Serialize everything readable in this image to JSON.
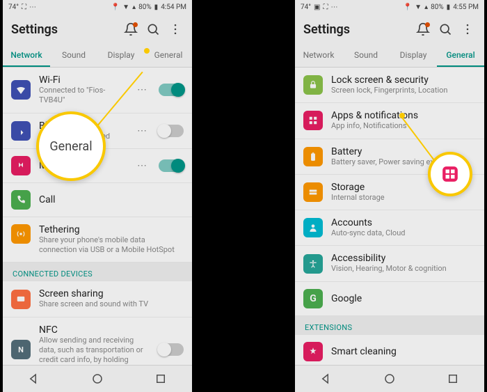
{
  "left": {
    "statusbar": {
      "temp": "74°",
      "battery": "80%",
      "time": "4:54 PM"
    },
    "title": "Settings",
    "tabs": [
      "Network",
      "Sound",
      "Display",
      "General"
    ],
    "active_tab": 0,
    "rows": {
      "wifi": {
        "title": "Wi-Fi",
        "sub": "Connected to \"Fios-TVB4U\"",
        "toggle": "on"
      },
      "bt": {
        "title": "Bluetooth",
        "sub": "Connections allowed",
        "toggle": "off"
      },
      "data": {
        "title": "Mobile data",
        "toggle": "on"
      },
      "call": {
        "title": "Call"
      },
      "tether": {
        "title": "Tethering",
        "sub": "Share your phone's mobile data connection via USB or a Mobile HotSpot"
      },
      "sect1": "CONNECTED DEVICES",
      "share": {
        "title": "Screen sharing",
        "sub": "Share screen and sound with TV"
      },
      "nfc": {
        "title": "NFC",
        "sub": "Allow sending and receiving data, such as transportation or credit card info, by holding phone and other device together",
        "toggle": "off"
      }
    },
    "callout_label": "General"
  },
  "right": {
    "statusbar": {
      "temp": "74°",
      "battery": "80%",
      "time": "4:55 PM"
    },
    "title": "Settings",
    "tabs": [
      "Network",
      "Sound",
      "Display",
      "General"
    ],
    "active_tab": 3,
    "rows": {
      "lock": {
        "title": "Lock screen & security",
        "sub": "Screen lock, Fingerprints, Location"
      },
      "apps": {
        "title": "Apps & notifications",
        "sub": "App info, Notifications"
      },
      "batt": {
        "title": "Battery",
        "sub": "Battery saver, Power saving exclusions"
      },
      "stor": {
        "title": "Storage",
        "sub": "Internal storage"
      },
      "acct": {
        "title": "Accounts",
        "sub": "Auto-sync data, Cloud"
      },
      "acc": {
        "title": "Accessibility",
        "sub": "Vision, Hearing, Motor & cognition"
      },
      "goog": {
        "title": "Google"
      },
      "sect": "EXTENSIONS",
      "smart": {
        "title": "Smart cleaning"
      }
    }
  },
  "icon_colors": {
    "wifi": "#3f51b5",
    "bt": "#3f51b5",
    "data": "#e91e63",
    "call": "#4caf50",
    "tether": "#ff9800",
    "share": "#ff7043",
    "nfc": "#546e7a",
    "lock": "#8bc34a",
    "apps": "#e91e63",
    "batt": "#ff9800",
    "stor": "#ff9800",
    "acct": "#00bcd4",
    "acc": "#26a69a",
    "goog": "#4caf50",
    "smart": "#e91e63"
  }
}
